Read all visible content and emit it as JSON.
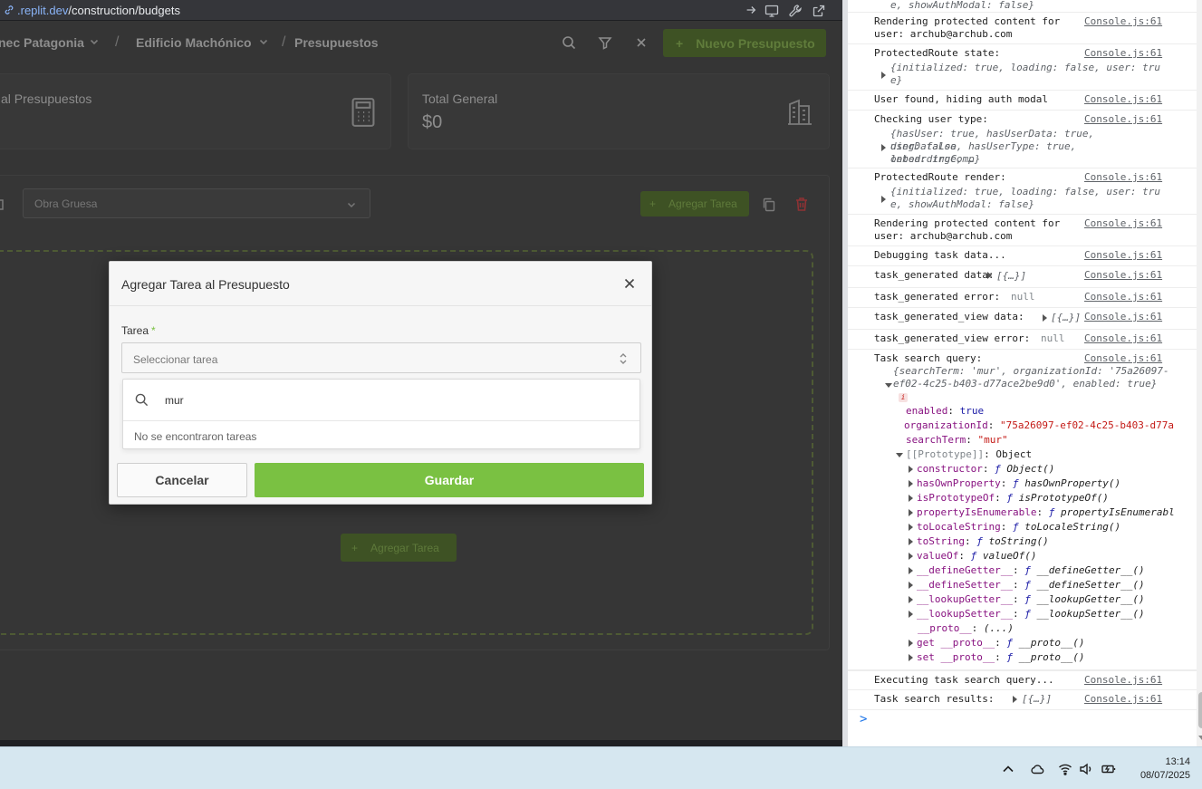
{
  "browser": {
    "url_host": ".replit.dev",
    "url_path": "/construction/budgets"
  },
  "page": {
    "breadcrumb": [
      "nec Patagonia",
      "Edificio Machónico",
      "Presupuestos"
    ],
    "breadcrumb_separator": "/",
    "new_budget_button": "Nuevo Presupuesto",
    "stats": [
      {
        "label": "al Presupuestos",
        "value": ""
      },
      {
        "label": "Total General",
        "value": "$0"
      }
    ],
    "category_select_value": "Obra Gruesa",
    "add_task_button": "Agregar Tarea",
    "add_task_button_bottom": "Agregar Tarea"
  },
  "modal": {
    "title": "Agregar Tarea al Presupuesto",
    "field_label": "Tarea",
    "required_mark": "*",
    "select_placeholder": "Seleccionar tarea",
    "search_value": "mur",
    "empty_message": "No se encontraron tareas",
    "cancel_label": "Cancelar",
    "save_label": "Guardar"
  },
  "console": {
    "source": "Console.js:61",
    "rows": [
      {
        "msg": "e, showAuthModal: false}",
        "src": ""
      },
      {
        "msg": "Rendering protected content for user: archub@archub.com",
        "src": "Console.js:61"
      },
      {
        "msg": "ProtectedRoute state:",
        "src": "Console.js:61"
      },
      {
        "msg": "User found, hiding auth modal",
        "src": "Console.js:61"
      },
      {
        "msg": "Checking user type:",
        "src": "Console.js:61"
      },
      {
        "msg": "ProtectedRoute render:",
        "src": "Console.js:61"
      },
      {
        "msg": "Rendering protected content for user: archub@archub.com",
        "src": "Console.js:61"
      },
      {
        "msg": "Debugging task data...",
        "src": "Console.js:61"
      },
      {
        "msg": "task_generated data:",
        "src": "Console.js:61"
      },
      {
        "msg": "task_generated error:",
        "src": "Console.js:61"
      },
      {
        "msg": "task_generated_view data:",
        "src": "Console.js:61"
      },
      {
        "msg": "task_generated_view error:",
        "src": "Console.js:61"
      },
      {
        "msg": "Task search query:",
        "src": "Console.js:61"
      },
      {
        "msg": "Executing task search query...",
        "src": "Console.js:61"
      },
      {
        "msg": "Task search results:",
        "src": "Console.js:61"
      }
    ],
    "null_text": "null",
    "array_preview": "[{…}]",
    "state_obj_line1": "{initialized: true, loading: false, user: tru",
    "state_obj_line2": "e}",
    "usertype_line1": "{hasUser: true, hasUserData: true, userDataLoa",
    "usertype_line2": "ding: false, hasUserType: true, onboardingComp",
    "usertype_line3": "leted: true, …}",
    "render_obj_line1": "{initialized: true, loading: false, user: tru",
    "render_obj_line2": "e, showAuthModal: false}",
    "query_line1": "{searchTerm: 'mur', organizationId: '75a26097-",
    "query_line2": "ef02-4c25-b403-d77ace2be9d0', enabled: true}",
    "query_props": {
      "enabled_key": "enabled",
      "enabled_val": "true",
      "org_key": "organizationId",
      "org_val": "\"75a26097-ef02-4c25-b403-d77a",
      "term_key": "searchTerm",
      "term_val": "\"mur\"",
      "proto_key": "[[Prototype]]",
      "proto_val": "Object"
    },
    "proto_members": [
      {
        "key": "constructor",
        "val": "Object()"
      },
      {
        "key": "hasOwnProperty",
        "val": "hasOwnProperty()"
      },
      {
        "key": "isPrototypeOf",
        "val": "isPrototypeOf()"
      },
      {
        "key": "propertyIsEnumerable",
        "val": "propertyIsEnumerabl"
      },
      {
        "key": "toLocaleString",
        "val": "toLocaleString()"
      },
      {
        "key": "toString",
        "val": "toString()"
      },
      {
        "key": "valueOf",
        "val": "valueOf()"
      },
      {
        "key": "__defineGetter__",
        "val": "__defineGetter__()"
      },
      {
        "key": "__defineSetter__",
        "val": "__defineSetter__()"
      },
      {
        "key": "__lookupGetter__",
        "val": "__lookupGetter__()"
      },
      {
        "key": "__lookupSetter__",
        "val": "__lookupSetter__()"
      },
      {
        "key": "__proto__",
        "val": "(...)"
      },
      {
        "key": "get __proto__",
        "val": "__proto__()"
      },
      {
        "key": "set __proto__",
        "val": "__proto__()"
      }
    ],
    "prompt": ">"
  },
  "taskbar": {
    "time": "13:14",
    "date": "08/07/2025"
  },
  "colors": {
    "accent_green": "#7ac142",
    "link_blue": "#8ab4f8",
    "danger_red": "#8e3234"
  }
}
